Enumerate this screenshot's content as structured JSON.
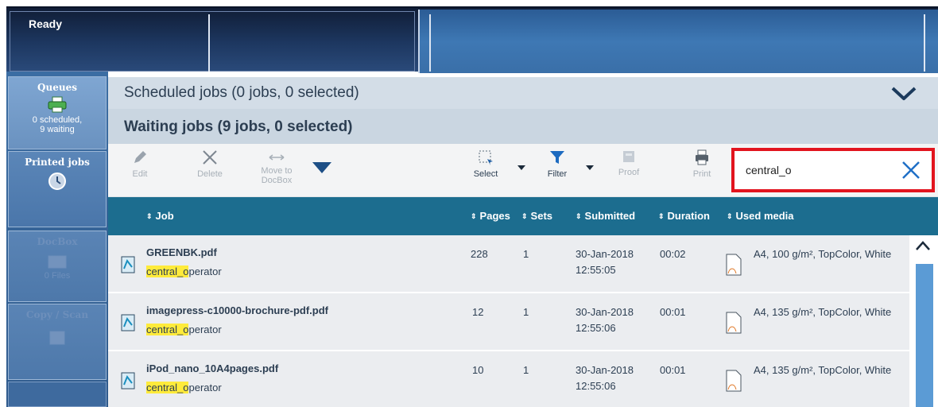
{
  "status_bar": {
    "status": "Ready"
  },
  "nav": {
    "queues": {
      "label": "Queues",
      "line1": "0 scheduled,",
      "line2": "9 waiting"
    },
    "printed_jobs": {
      "label": "Printed jobs"
    },
    "docbox": {
      "label": "DocBox",
      "line1": "0 Files"
    },
    "copy_scan": {
      "label": "Copy / Scan"
    }
  },
  "scheduled_header": {
    "title": "Scheduled jobs (0 jobs, 0 selected)"
  },
  "waiting_header": {
    "title": "Waiting jobs (9 jobs, 0 selected)"
  },
  "toolbar": {
    "edit": "Edit",
    "delete": "Delete",
    "move_line1": "Move to",
    "move_line2": "DocBox",
    "select": "Select",
    "filter": "Filter",
    "proof": "Proof",
    "print": "Print"
  },
  "search": {
    "value": "central_o"
  },
  "table": {
    "columns": {
      "job": "Job",
      "pages": "Pages",
      "sets": "Sets",
      "submitted": "Submitted",
      "duration": "Duration",
      "media": "Used media"
    },
    "rows": [
      {
        "name": "GREENBK.pdf",
        "owner_match": "central_o",
        "owner_rest": "perator",
        "pages": "228",
        "sets": "1",
        "date": "30-Jan-2018",
        "time": "12:55:05",
        "duration": "00:02",
        "media": "A4, 100 g/m², TopColor, White"
      },
      {
        "name": "imagepress-c10000-brochure-pdf.pdf",
        "owner_match": "central_o",
        "owner_rest": "perator",
        "pages": "12",
        "sets": "1",
        "date": "30-Jan-2018",
        "time": "12:55:06",
        "duration": "00:01",
        "media": "A4, 135 g/m², TopColor, White"
      },
      {
        "name": "iPod_nano_10A4pages.pdf",
        "owner_match": "central_o",
        "owner_rest": "perator",
        "pages": "10",
        "sets": "1",
        "date": "30-Jan-2018",
        "time": "12:55:06",
        "duration": "00:01",
        "media": "A4, 135 g/m², TopColor, White"
      }
    ]
  },
  "colors": {
    "table_header": "#1c6d8f",
    "search_highlight": "#e2141e",
    "match_highlight": "#ffeb3b",
    "scroll_thumb": "#5b9bd5",
    "nav_active": "#7fa6d2"
  },
  "icons": {
    "edit": "pencil-icon",
    "delete": "close-icon",
    "move": "arrows-horizontal-icon",
    "more": "triangle-down-icon",
    "select": "select-icon",
    "filter": "funnel-icon",
    "proof": "proof-icon",
    "print": "printer-icon",
    "clear": "clear-search-icon",
    "collapse": "chevron-down-icon",
    "scroll_up": "chevron-up-icon"
  }
}
